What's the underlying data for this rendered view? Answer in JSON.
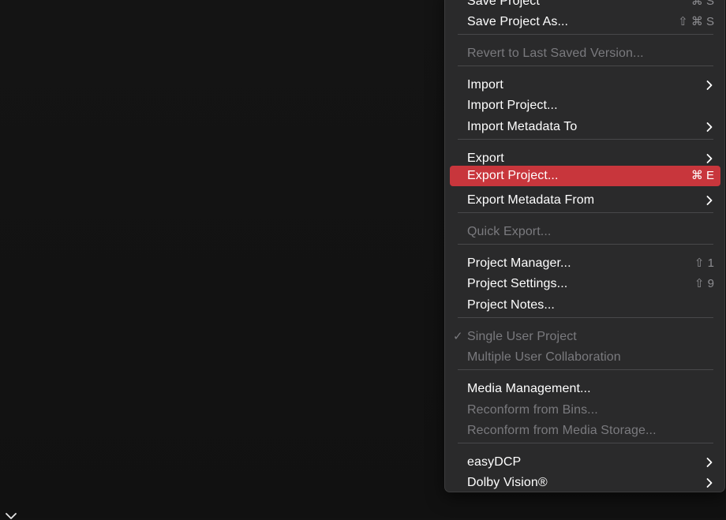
{
  "menu": {
    "items": [
      {
        "label": "Save Project",
        "shortcut": "⌘ S",
        "disabled": false
      },
      {
        "label": "Save Project As...",
        "shortcut": "⇧ ⌘ S",
        "disabled": false
      },
      {
        "label": "Revert to Last Saved Version...",
        "shortcut": "",
        "disabled": true
      },
      {
        "label": "Import",
        "submenu": true,
        "disabled": false
      },
      {
        "label": "Import Project...",
        "shortcut": "",
        "disabled": false
      },
      {
        "label": "Import Metadata To",
        "submenu": true,
        "disabled": false
      },
      {
        "label": "Export",
        "submenu": true,
        "disabled": false
      },
      {
        "label": "Export Project...",
        "shortcut": "⌘ E",
        "disabled": false,
        "highlighted": true
      },
      {
        "label": "Export Metadata From",
        "submenu": true,
        "disabled": false
      },
      {
        "label": "Quick Export...",
        "shortcut": "",
        "disabled": true
      },
      {
        "label": "Project Manager...",
        "shortcut": "⇧ 1",
        "disabled": false
      },
      {
        "label": "Project Settings...",
        "shortcut": "⇧ 9",
        "disabled": false
      },
      {
        "label": "Project Notes...",
        "shortcut": "",
        "disabled": false
      },
      {
        "label": "Single User Project",
        "check": "✓",
        "disabled": true
      },
      {
        "label": "Multiple User Collaboration",
        "shortcut": "",
        "disabled": true
      },
      {
        "label": "Media Management...",
        "shortcut": "",
        "disabled": false
      },
      {
        "label": "Reconform from Bins...",
        "shortcut": "",
        "disabled": true
      },
      {
        "label": "Reconform from Media Storage...",
        "shortcut": "",
        "disabled": true
      },
      {
        "label": "easyDCP",
        "submenu": true,
        "disabled": false
      },
      {
        "label": "Dolby Vision®",
        "submenu": true,
        "disabled": false
      }
    ]
  },
  "colors": {
    "highlight": "#c8363c",
    "menu_background": "#2a2a2b",
    "disabled_text": "#7a7a7e",
    "shortcut_text": "#8e8e92"
  },
  "icons": {
    "submenu": "chevron-right-icon",
    "check": "checkmark-icon",
    "corner": "chevron-down-icon"
  }
}
